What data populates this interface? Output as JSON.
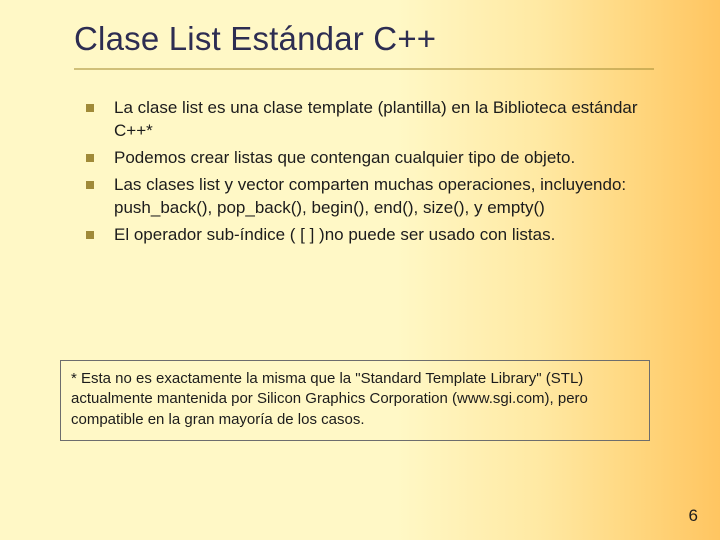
{
  "title": "Clase List Estándar C++",
  "bullets": {
    "b0": "La clase list es una clase template (plantilla) en la Biblioteca estándar C++*",
    "b1": "Podemos crear listas que contengan cualquier tipo de objeto.",
    "b2": "Las clases list y vector comparten muchas operaciones, incluyendo: push_back(), pop_back(), begin(), end(), size(), y empty()",
    "b3": "El operador sub-índice ( [ ] )no puede ser usado con listas."
  },
  "footnote": "* Esta no es exactamente la misma que la \"Standard Template Library\" (STL) actualmente mantenida por Silicon Graphics Corporation (www.sgi.com), pero compatible en la gran mayoría de los casos.",
  "page_number": "6"
}
